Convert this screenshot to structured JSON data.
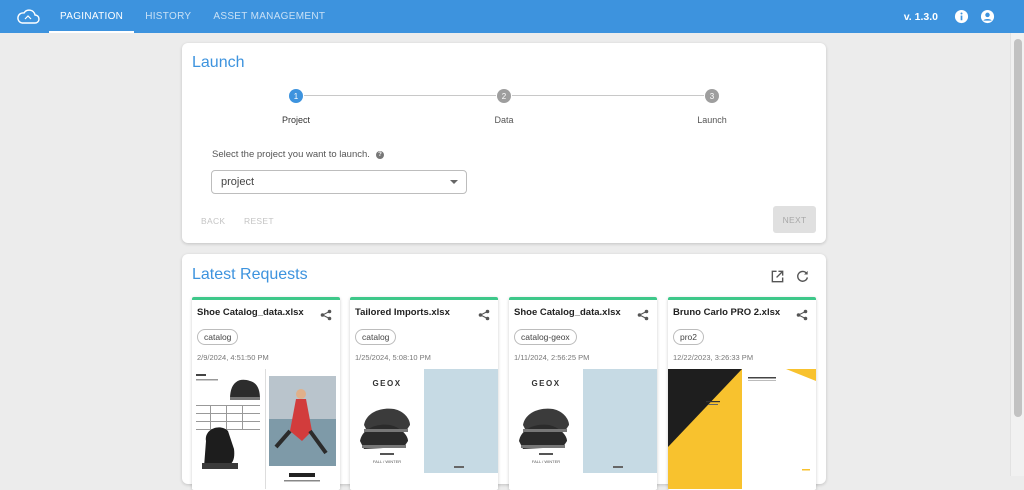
{
  "topbar": {
    "logo_icon": "cloud-icon",
    "nav": [
      "PAGINATION",
      "HISTORY",
      "ASSET MANAGEMENT"
    ],
    "active_nav": "PAGINATION",
    "version": "v. 1.3.0",
    "info_icon": "info-icon",
    "account_icon": "account-icon"
  },
  "launch": {
    "title": "Launch",
    "steps": [
      {
        "number": "1",
        "label": "Project",
        "active": true
      },
      {
        "number": "2",
        "label": "Data",
        "active": false
      },
      {
        "number": "3",
        "label": "Launch",
        "active": false
      }
    ],
    "prompt": "Select the project you want to launch.",
    "help_icon": "help-icon",
    "select_placeholder": "project",
    "back_label": "BACK",
    "reset_label": "RESET",
    "next_label": "NEXT"
  },
  "latest": {
    "title": "Latest Requests",
    "open_icon": "open-in-new-icon",
    "refresh_icon": "refresh-icon",
    "requests": [
      {
        "title": "Shoe Catalog_data.xlsx",
        "tag": "catalog",
        "date": "2/9/2024, 4:51:50 PM",
        "thumbnail": "catalog-spread"
      },
      {
        "title": "Tailored Imports.xlsx",
        "tag": "catalog",
        "date": "1/25/2024, 5:08:10 PM",
        "thumbnail": "geox-cover",
        "brand": "GEOX",
        "caption": "FALL / WINTER"
      },
      {
        "title": "Shoe Catalog_data.xlsx",
        "tag": "catalog-geox",
        "date": "1/11/2024, 2:56:25 PM",
        "thumbnail": "geox-cover",
        "brand": "GEOX",
        "caption": "FALL / WINTER"
      },
      {
        "title": "Bruno Carlo PRO 2.xlsx",
        "tag": "pro2",
        "date": "12/22/2023, 3:26:33 PM",
        "thumbnail": "yellow-cover"
      }
    ]
  },
  "colors": {
    "primary": "#3d93de",
    "accent": "#3ec88a",
    "yellow": "#f8c22e"
  }
}
